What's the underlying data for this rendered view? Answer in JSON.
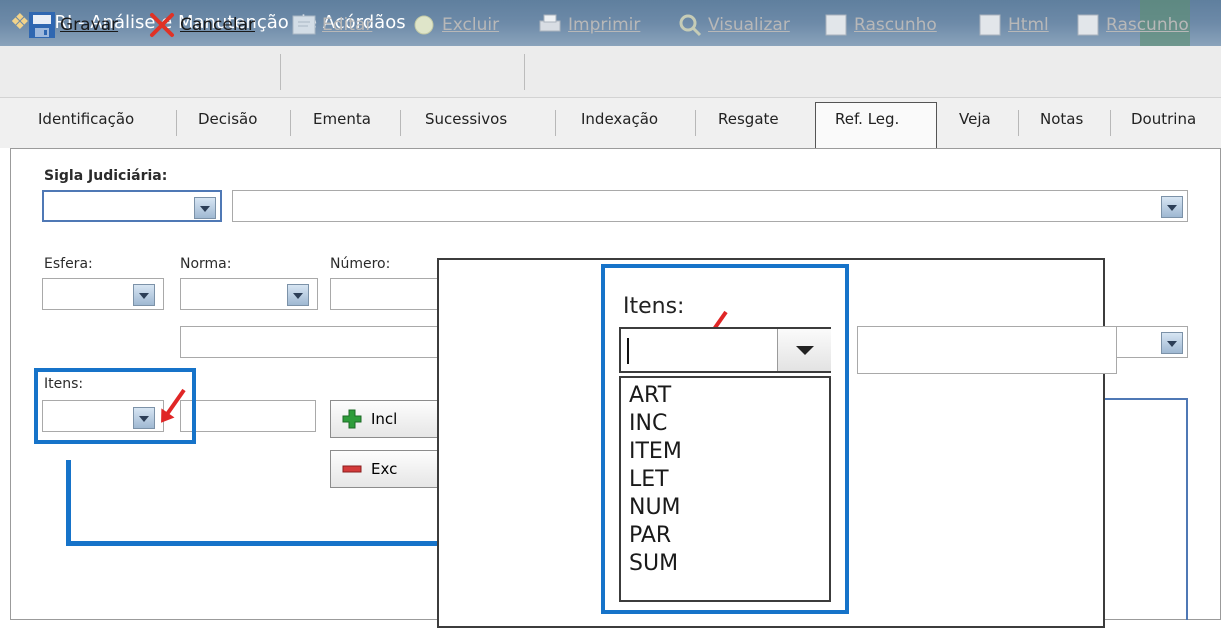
{
  "window": {
    "title": "JURI - Análise e Manutenção de Acórdãos",
    "app_icon": "app-logo-icon"
  },
  "toolbar": {
    "gravar": "Gravar",
    "cancelar": "Cancelar",
    "editar": "Editar",
    "excluir": "Excluir",
    "imprimir": "Imprimir",
    "visualizar": "Visualizar",
    "rascunho1": "Rascunho",
    "html": "Html",
    "rascunho2": "Rascunho"
  },
  "tabs": {
    "identificacao": "Identificação",
    "decisao": "Decisão",
    "ementa": "Ementa",
    "sucessivos": "Sucessivos",
    "indexacao": "Indexação",
    "resgate": "Resgate",
    "refleg": "Ref. Leg.",
    "veja": "Veja",
    "notas": "Notas",
    "doutrina": "Doutrina",
    "selected": "Ref. Leg."
  },
  "form": {
    "sigla_label": "Sigla Judiciária:",
    "esfera_label": "Esfera:",
    "norma_label": "Norma:",
    "numero_label": "Número:",
    "itens_label": "Itens:",
    "incluir_partial": "Incl",
    "excluir_partial": "Exc"
  },
  "zoom": {
    "itens_label": "Itens:",
    "options": [
      "ART",
      "INC",
      "ITEM",
      "LET",
      "NUM",
      "PAR",
      "SUM"
    ]
  },
  "colors": {
    "highlight": "#1673c9",
    "arrow_red": "#e02626",
    "titlebar": "#6d8aa8"
  }
}
